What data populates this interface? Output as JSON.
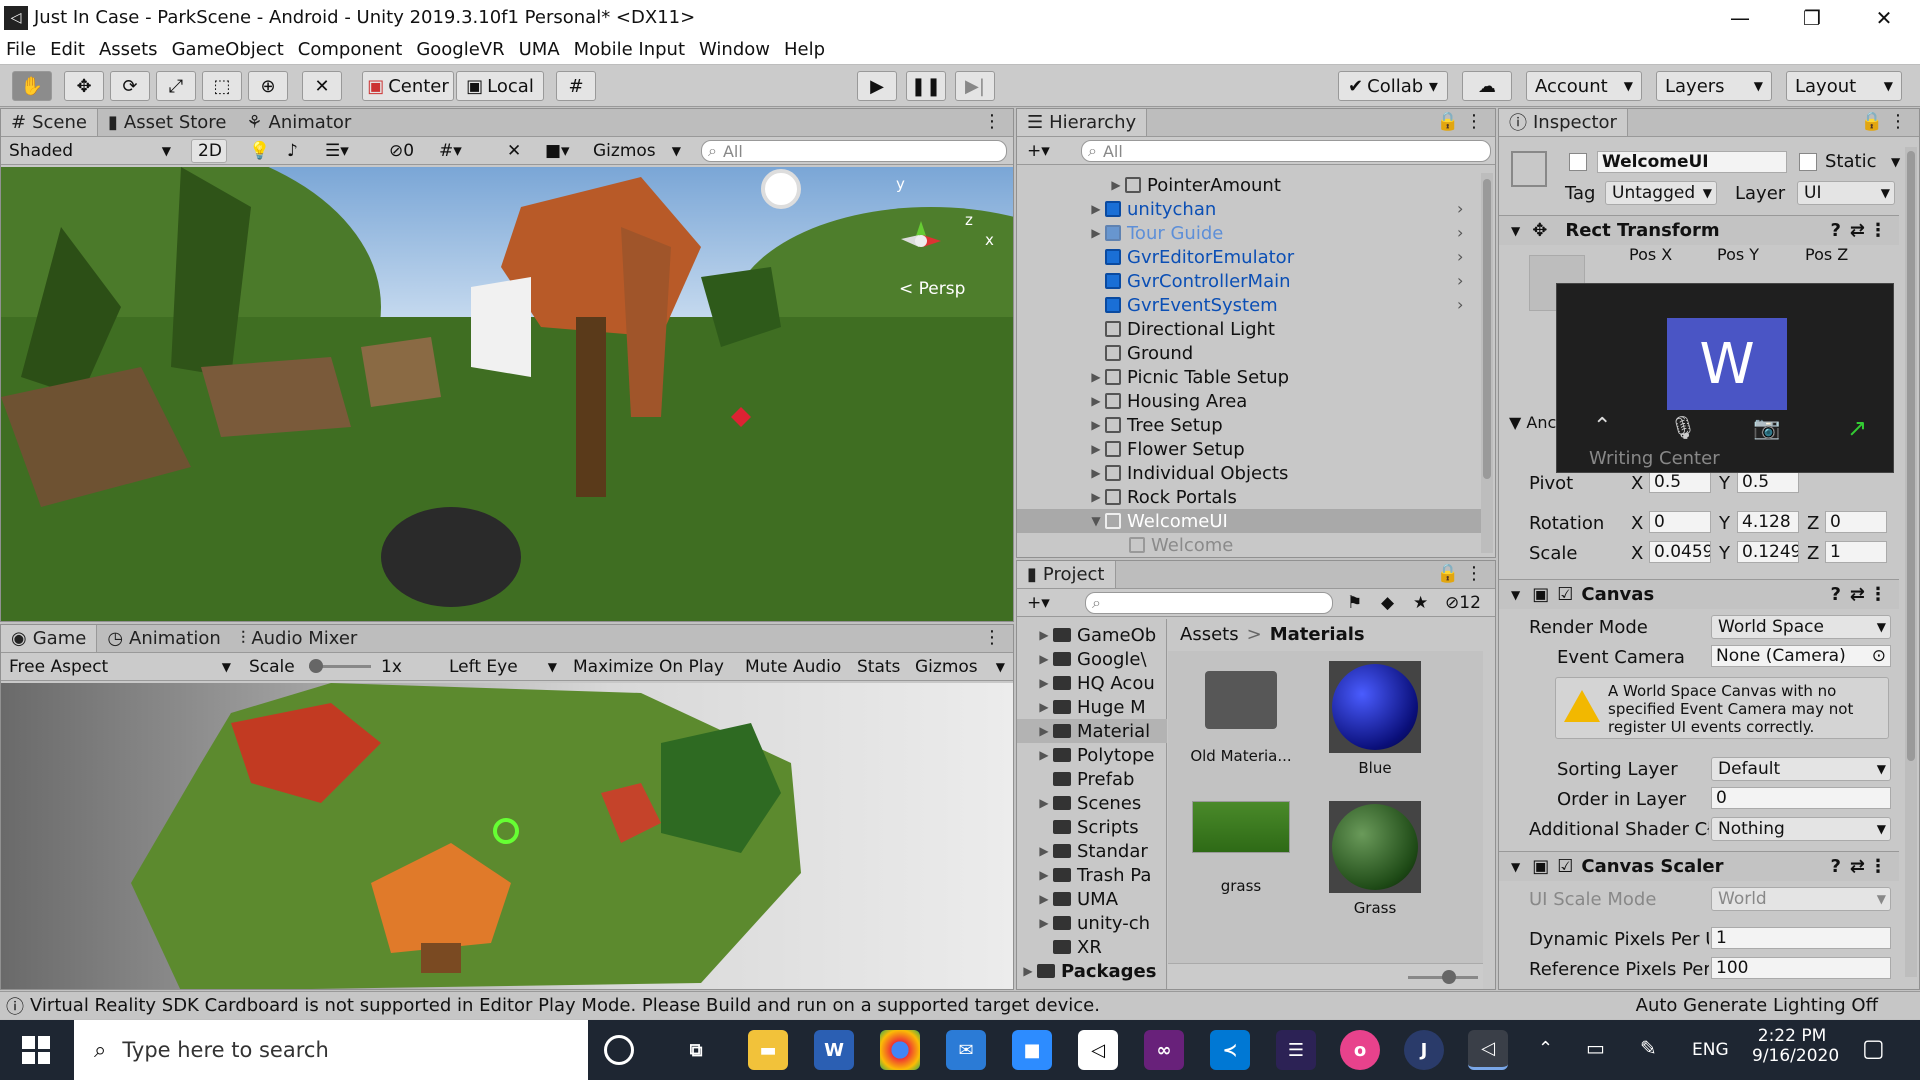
{
  "window": {
    "title": "Just In Case - ParkScene - Android - Unity 2019.3.10f1 Personal* <DX11>",
    "min": "—",
    "max": "❐",
    "close": "✕"
  },
  "menu": [
    "File",
    "Edit",
    "Assets",
    "GameObject",
    "Component",
    "GoogleVR",
    "UMA",
    "Mobile Input",
    "Window",
    "Help"
  ],
  "toolbar": {
    "center": "Center",
    "local": "Local",
    "collab": "Collab ▾",
    "account": "Account",
    "layers": "Layers",
    "layout": "Layout"
  },
  "scene": {
    "tabs": [
      "Scene",
      "Asset Store",
      "Animator"
    ],
    "shading": "Shaded",
    "mode2d": "2D",
    "hidden_count": "0",
    "gizmos": "Gizmos",
    "search_placeholder": "All",
    "persp": "< Persp",
    "axis_y": "y",
    "axis_x": "x",
    "axis_z": "z"
  },
  "game": {
    "tabs": [
      "Game",
      "Animation",
      "Audio Mixer"
    ],
    "aspect": "Free Aspect",
    "scale_label": "Scale",
    "scale_value": "1x",
    "eye": "Left Eye",
    "maximize": "Maximize On Play",
    "mute": "Mute Audio",
    "stats": "Stats",
    "gizmos": "Gizmos"
  },
  "hierarchy": {
    "tab": "Hierarchy",
    "search_placeholder": "All",
    "items": [
      {
        "label": "PointerAmount",
        "color": "#111111"
      },
      {
        "label": "unitychan",
        "color": "#0b4fb5"
      },
      {
        "label": "Tour Guide",
        "color": "#5d8fd8"
      },
      {
        "label": "GvrEditorEmulator",
        "color": "#0b4fb5"
      },
      {
        "label": "GvrControllerMain",
        "color": "#0b4fb5"
      },
      {
        "label": "GvrEventSystem",
        "color": "#0b4fb5"
      },
      {
        "label": "Directional Light",
        "color": "#111111"
      },
      {
        "label": "Ground",
        "color": "#111111"
      },
      {
        "label": "Picnic Table Setup",
        "color": "#111111"
      },
      {
        "label": "Housing Area",
        "color": "#111111"
      },
      {
        "label": "Tree Setup",
        "color": "#111111"
      },
      {
        "label": "Flower Setup",
        "color": "#111111"
      },
      {
        "label": "Individual Objects",
        "color": "#111111"
      },
      {
        "label": "Rock Portals",
        "color": "#111111"
      },
      {
        "label": "WelcomeUI",
        "color": "#ffffff"
      },
      {
        "label": "Welcome",
        "color": "#8a8a8a"
      }
    ]
  },
  "project": {
    "tab": "Project",
    "hidden_count": "12",
    "folders": [
      "GameOb",
      "Google\\",
      "HQ Acou",
      "Huge M",
      "Material",
      "Polytope",
      "Prefab",
      "Scenes",
      "Scripts",
      "Standar",
      "Trash Pa",
      "UMA",
      "unity-ch",
      "XR"
    ],
    "packages": "Packages",
    "breadcrumb_root": "Assets",
    "breadcrumb_sep": ">",
    "breadcrumb_current": "Materials",
    "assets": [
      "Old Materia...",
      "Blue",
      "grass",
      "Grass"
    ]
  },
  "inspector": {
    "tab": "Inspector",
    "name": "WelcomeUI",
    "static": "Static",
    "tag_label": "Tag",
    "tag_value": "Untagged",
    "layer_label": "Layer",
    "layer_value": "UI",
    "rect_transform": "Rect Transform",
    "pos_x": "Pos X",
    "pos_y": "Pos Y",
    "pos_z": "Pos Z",
    "anchors": "Anc",
    "pivot_label": "Pivot",
    "pivot_x": "0.5",
    "pivot_y": "0.5",
    "rotation_label": "Rotation",
    "rot_x": "0",
    "rot_y": "4.128",
    "rot_z": "0",
    "scale_label": "Scale",
    "scale_x": "0.0459",
    "scale_y": "0.1249",
    "scale_z": "1",
    "canvas": "Canvas",
    "render_mode_label": "Render Mode",
    "render_mode": "World Space",
    "event_camera_label": "Event Camera",
    "event_camera": "None (Camera)",
    "warning": "A World Space Canvas with no specified Event Camera may not register UI events correctly.",
    "sorting_layer_label": "Sorting Layer",
    "sorting_layer": "Default",
    "order_label": "Order in Layer",
    "order": "0",
    "shader_label": "Additional Shader Cł",
    "shader": "Nothing",
    "canvas_scaler": "Canvas Scaler",
    "ui_scale_label": "UI Scale Mode",
    "ui_scale": "World",
    "dpp_label": "Dynamic Pixels Per U",
    "dpp": "1",
    "rpp_label": "Reference Pixels Per",
    "rpp": "100"
  },
  "overlay": {
    "letter": "W",
    "caption": "Writing Center"
  },
  "status": {
    "message": "Virtual Reality SDK Cardboard is not supported in Editor Play Mode. Please Build and run on a supported target device.",
    "lighting": "Auto Generate Lighting Off"
  },
  "taskbar": {
    "search_placeholder": "Type here to search",
    "lang": "ENG",
    "time": "2:22 PM",
    "date": "9/16/2020"
  }
}
